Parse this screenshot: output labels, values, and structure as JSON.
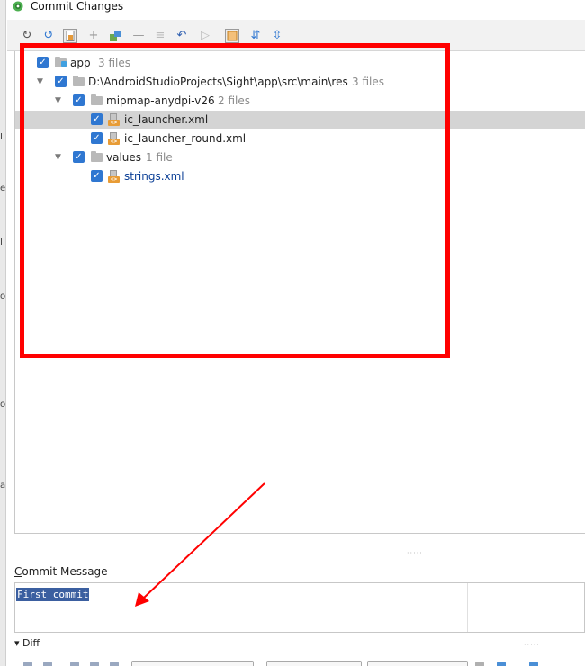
{
  "window": {
    "title": "Commit Changes",
    "icon": "android-studio-icon"
  },
  "toolbar": {
    "icons": [
      "refresh-icon",
      "rollback-icon",
      "show-diff-icon",
      "add-icon",
      "move-to-changelist-icon",
      "remove-icon",
      "group-by-directory-icon",
      "undo-icon",
      "forward-icon",
      "select-changes-icon",
      "expand-all-icon",
      "collapse-all-icon"
    ]
  },
  "tree": {
    "rows": [
      {
        "label": "app",
        "count": "3 files",
        "checked": true,
        "modified": false
      },
      {
        "label": "D:\\AndroidStudioProjects\\Sight\\app\\src\\main\\res",
        "count": "3 files",
        "checked": true,
        "modified": false
      },
      {
        "label": "mipmap-anydpi-v26",
        "count": "2 files",
        "checked": true,
        "modified": false
      },
      {
        "label": "ic_launcher.xml",
        "count": "",
        "checked": true,
        "modified": false,
        "selected": true
      },
      {
        "label": "ic_launcher_round.xml",
        "count": "",
        "checked": true,
        "modified": false
      },
      {
        "label": "values",
        "count": "1 file",
        "checked": true,
        "modified": false
      },
      {
        "label": "strings.xml",
        "count": "",
        "checked": true,
        "modified": true
      }
    ]
  },
  "commit_message": {
    "title_mnemonic": "C",
    "title_rest": "ommit Message",
    "value": "First commit"
  },
  "diff": {
    "label": "Diff"
  },
  "annotation": {
    "highlight_color": "#ff0000",
    "arrow_color": "#ff0000"
  }
}
